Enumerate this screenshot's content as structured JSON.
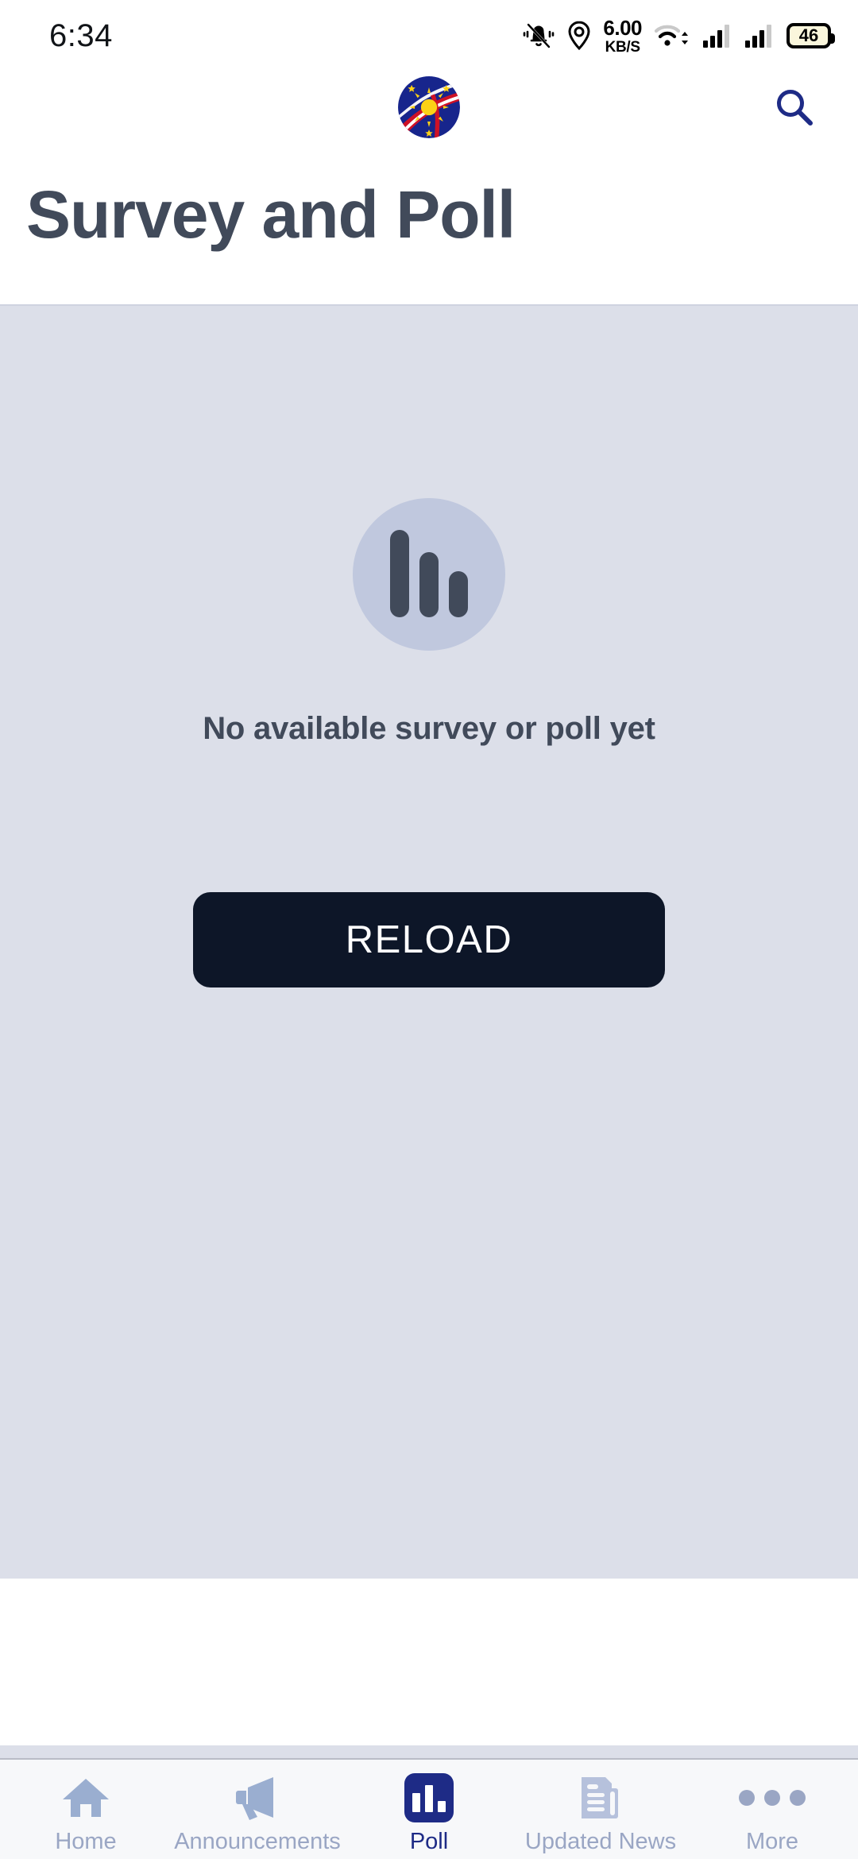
{
  "statusbar": {
    "time": "6:34",
    "network_speed_value": "6.00",
    "network_speed_unit": "KB/S",
    "battery_level": "46",
    "icons": [
      "vibrate-icon",
      "location-icon",
      "wifi-icon",
      "signal-icon",
      "signal-icon",
      "battery-icon"
    ]
  },
  "header": {
    "logo_alt": "app-logo",
    "search_label": "search-icon",
    "title": "Survey and Poll"
  },
  "empty_state": {
    "icon": "bar-chart-icon",
    "message": "No available survey or poll yet",
    "reload_label": "RELOAD"
  },
  "bottom_nav": {
    "items": [
      {
        "label": "Home",
        "icon": "home-icon",
        "active": false
      },
      {
        "label": "Announcements",
        "icon": "megaphone-icon",
        "active": false
      },
      {
        "label": "Poll",
        "icon": "poll-bar-chart-icon",
        "active": true
      },
      {
        "label": "Updated News",
        "icon": "newspaper-icon",
        "active": false
      },
      {
        "label": "More",
        "icon": "more-dots-icon",
        "active": false
      }
    ]
  },
  "colors": {
    "accent_navy": "#1e2b86",
    "title_slate": "#414a5a",
    "content_bg": "#dcdfe9",
    "button_dark": "#0d1628",
    "nav_inactive": "#9aa6c4"
  }
}
